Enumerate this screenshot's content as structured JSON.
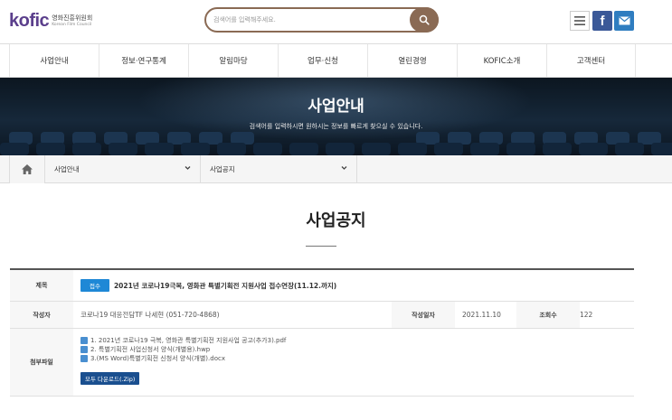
{
  "header": {
    "logo_mark": "kofic",
    "logo_korean": "영화진흥위원회",
    "logo_english": "Korean Film Council",
    "search_placeholder": "검색어를 입력해주세요.",
    "icons": [
      "search-icon",
      "menu-icon",
      "facebook-icon",
      "mail-icon"
    ],
    "facebook_glyph": "f"
  },
  "gnb": {
    "items": [
      "사업안내",
      "정보·연구통계",
      "알림마당",
      "업무·신청",
      "열린경영",
      "KOFIC소개",
      "고객센터"
    ]
  },
  "hero": {
    "title": "사업안내",
    "subtitle": "검색어를 입력하시면 원하시는 정보를 빠르게 찾으실 수 있습니다."
  },
  "location": {
    "level1": "사업안내",
    "level2": "사업공지"
  },
  "page": {
    "title": "사업공지"
  },
  "board": {
    "subject_label": "제목",
    "status_badge": "접수",
    "subject": "2021년 코로나19극복, 영화관 특별기획전 지원사업 접수연장(11.12.까지)",
    "author_label": "작성자",
    "author": "코로나19 대응전담TF 나세현 (051-720-4868)",
    "date_label": "작성일자",
    "date": "2021.11.10",
    "views_label": "조회수",
    "views": "122",
    "attach_label": "첨부파일",
    "files": [
      "1. 2021년 코로나19 극복, 영화관 특별기획전 지원사업 공고(추가3).pdf",
      "2. 특별기획전 사업신청서 양식(개별용).hwp",
      "3.(MS Word)특별기획전 신청서 양식(개별).docx"
    ],
    "download_all": "모두 다운로드(.Zip)"
  },
  "colors": {
    "brand_purple": "#5b3f8c",
    "brand_orange": "#e8741b",
    "search_brown": "#8a6a54",
    "badge_blue": "#1e88d6",
    "download_navy": "#1a4f8f"
  }
}
